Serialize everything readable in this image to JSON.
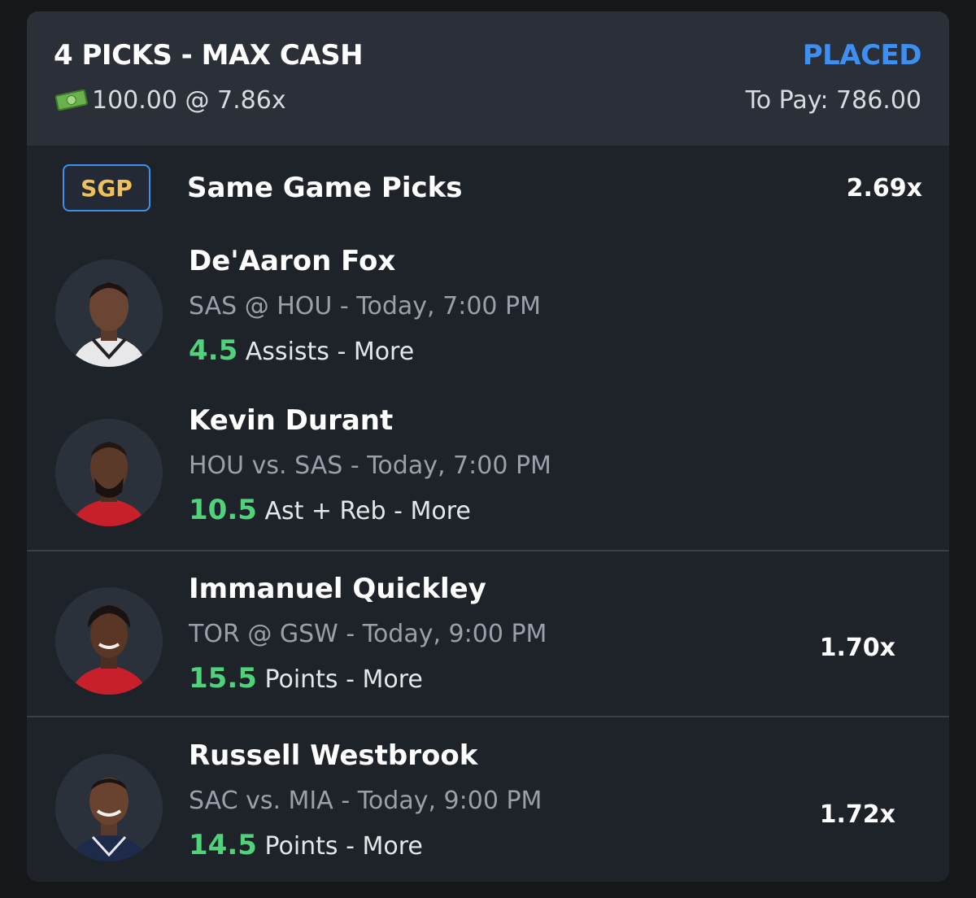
{
  "header": {
    "title": "4 PICKS - MAX CASH",
    "status": "PLACED",
    "stake_icon": "cash-money-icon",
    "stake": "100.00 @ 7.86x",
    "to_pay": "To Pay: 786.00"
  },
  "sgp": {
    "badge": "SGP",
    "title": "Same Game Picks",
    "multiplier": "2.69x"
  },
  "picks": [
    {
      "player": "De'Aaron Fox",
      "matchup": "SAS @ HOU",
      "time": "- Today, 7:00 PM",
      "line": "4.5",
      "stat": "Assists - More",
      "multiplier": ""
    },
    {
      "player": "Kevin Durant",
      "matchup": "HOU vs. SAS",
      "time": "- Today, 7:00 PM",
      "line": "10.5",
      "stat": "Ast + Reb - More",
      "multiplier": ""
    },
    {
      "player": "Immanuel Quickley",
      "matchup": "TOR @ GSW",
      "time": "- Today, 9:00 PM",
      "line": "15.5",
      "stat": "Points - More",
      "multiplier": "1.70x"
    },
    {
      "player": "Russell Westbrook",
      "matchup": "SAC vs. MIA",
      "time": "- Today, 9:00 PM",
      "line": "14.5",
      "stat": "Points - More",
      "multiplier": "1.72x"
    }
  ],
  "colors": {
    "accent_blue": "#3f8ff0",
    "line_green": "#4fd27a",
    "sgp_gold": "#f0c15a"
  }
}
